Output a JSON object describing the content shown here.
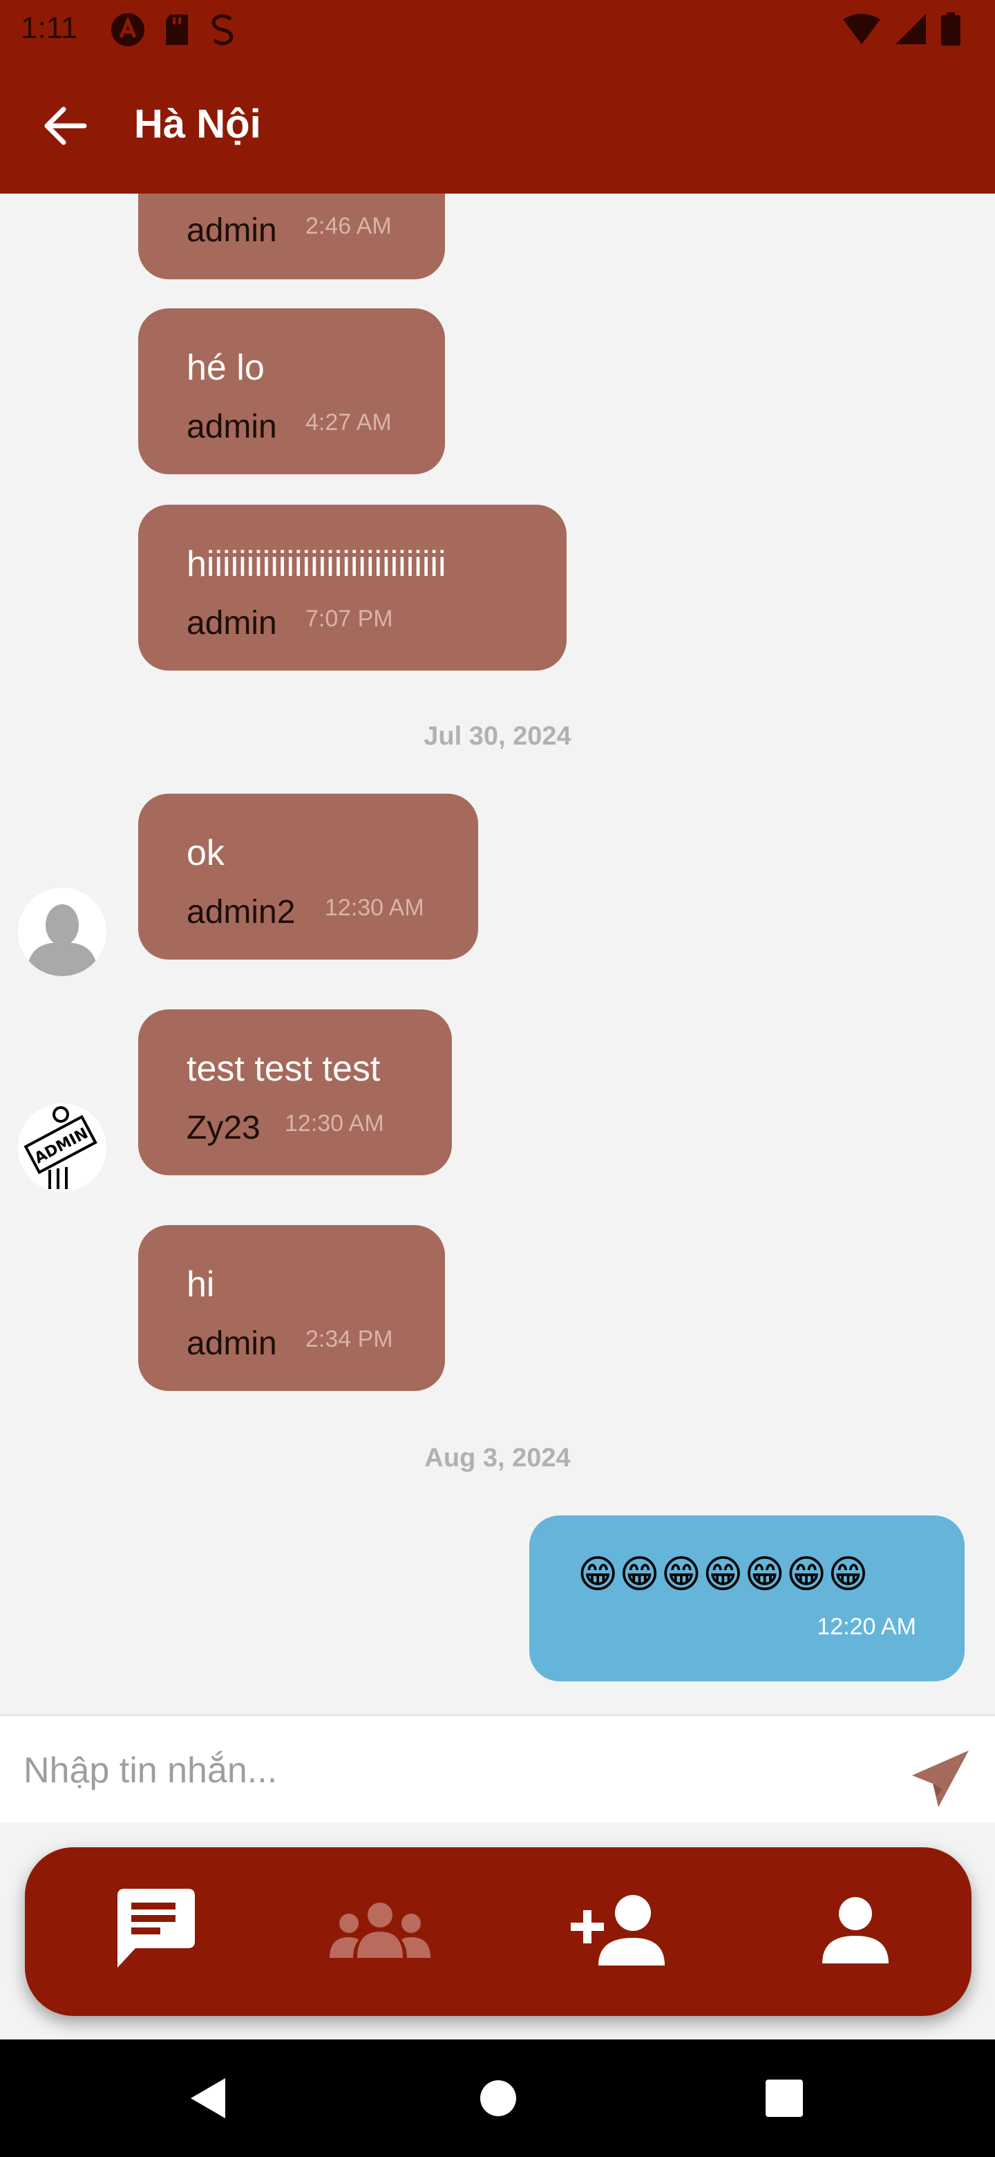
{
  "status_bar": {
    "time": "1:11",
    "left_icons": [
      "a-logo-icon",
      "sd-card-icon",
      "s-sync-icon"
    ],
    "right_icons": [
      "wifi-icon",
      "signal-icon",
      "battery-icon"
    ]
  },
  "app_bar": {
    "back_icon": "arrow-left-icon",
    "title": "Hà Nội"
  },
  "messages": [
    {
      "text": "",
      "sender": "admin",
      "time": "2:46 AM",
      "avatar": ""
    },
    {
      "text": "hé lo",
      "sender": "admin",
      "time": "4:27 AM",
      "avatar": ""
    },
    {
      "text": "hiiiiiiiiiiiiiiiiiiiiiiiiiiiiii",
      "sender": "admin",
      "time": "7:07 PM",
      "avatar": ""
    },
    {
      "text": "ok",
      "sender": "admin2",
      "time": "12:30 AM",
      "avatar": "default-person-icon"
    },
    {
      "text": "test test test",
      "sender": "Zy23",
      "time": "12:30 AM",
      "avatar": "admin-sign-icon"
    },
    {
      "text": "hi",
      "sender": "admin",
      "time": "2:34 PM",
      "avatar": ""
    }
  ],
  "date_separators": [
    "Jul 30, 2024",
    "Aug 3, 2024"
  ],
  "my_message": {
    "text": "😁😁😁😁😁😁😁",
    "time": "12:20 AM"
  },
  "composer": {
    "placeholder": "Nhập tin nhắn...",
    "send_icon": "paper-plane-icon"
  },
  "bottom_nav": {
    "items": [
      {
        "icon": "chat-icon",
        "active": true
      },
      {
        "icon": "groups-icon",
        "active": false
      },
      {
        "icon": "add-person-icon",
        "active": false
      },
      {
        "icon": "person-icon",
        "active": false
      }
    ]
  },
  "system_nav": [
    "back-triangle-icon",
    "home-circle-icon",
    "recents-square-icon"
  ],
  "colors": {
    "primary": "#8e1a05",
    "bubble_other": "#a56a5c",
    "bubble_mine": "#64b5d9",
    "background": "#f4f3f3",
    "inactive_nav": "#b96b5e"
  }
}
